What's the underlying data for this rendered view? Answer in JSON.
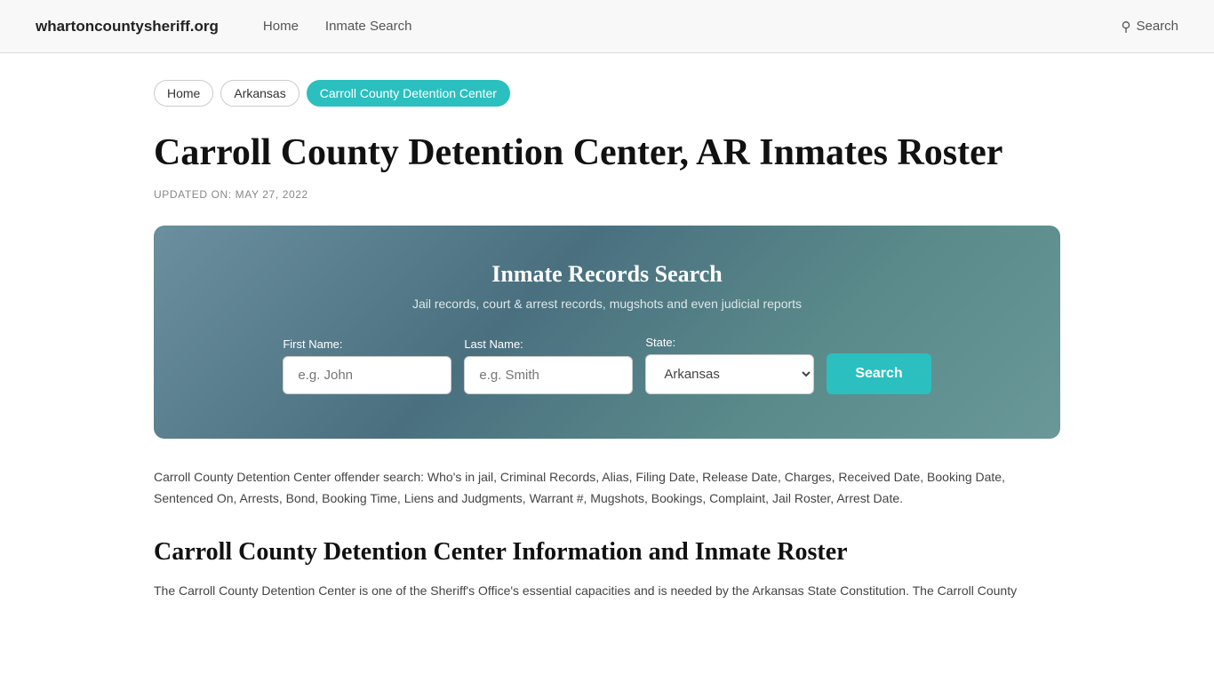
{
  "nav": {
    "brand": "whartoncountysheriff.org",
    "links": [
      {
        "label": "Home",
        "id": "nav-home"
      },
      {
        "label": "Inmate Search",
        "id": "nav-inmate-search"
      }
    ],
    "search_label": "Search"
  },
  "breadcrumb": {
    "items": [
      {
        "label": "Home",
        "active": false
      },
      {
        "label": "Arkansas",
        "active": false
      },
      {
        "label": "Carroll County Detention Center",
        "active": true
      }
    ]
  },
  "page": {
    "title": "Carroll County Detention Center, AR Inmates Roster",
    "updated_on": "UPDATED ON: MAY 27, 2022"
  },
  "search_widget": {
    "title": "Inmate Records Search",
    "subtitle": "Jail records, court & arrest records, mugshots and even judicial reports",
    "first_name_label": "First Name:",
    "first_name_placeholder": "e.g. John",
    "last_name_label": "Last Name:",
    "last_name_placeholder": "e.g. Smith",
    "state_label": "State:",
    "state_default": "Arkansas",
    "search_button": "Search"
  },
  "description": "Carroll County Detention Center offender search: Who's in jail, Criminal Records, Alias, Filing Date, Release Date, Charges, Received Date, Booking Date, Sentenced On, Arrests, Bond, Booking Time, Liens and Judgments, Warrant #, Mugshots, Bookings, Complaint, Jail Roster, Arrest Date.",
  "section": {
    "heading": "Carroll County Detention Center Information and Inmate Roster",
    "body": "The Carroll County Detention Center is one of the Sheriff's Office's essential capacities and is needed by the Arkansas State Constitution. The Carroll County"
  }
}
